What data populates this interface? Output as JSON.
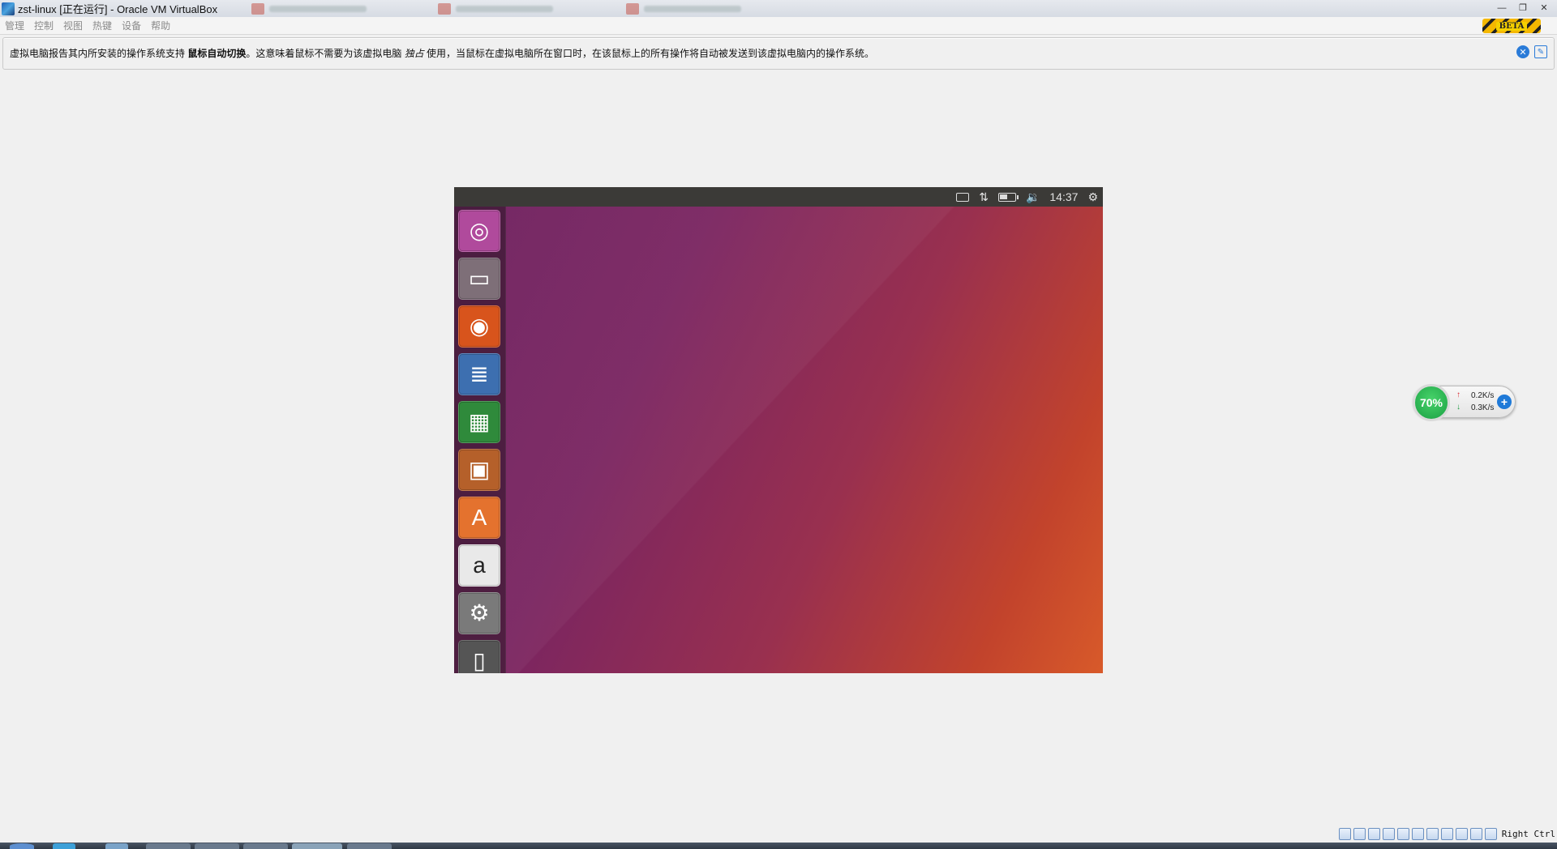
{
  "window": {
    "title": "zst-linux [正在运行] - Oracle VM VirtualBox",
    "controls": [
      "—",
      "❐",
      "✕"
    ]
  },
  "menu": [
    "管理",
    "控制",
    "视图",
    "热键",
    "设备",
    "帮助"
  ],
  "beta_label": "BETA",
  "notification": {
    "part1": "虚拟电脑报告其内所安装的操作系统支持 ",
    "bold": "鼠标自动切换",
    "part2": "。这意味着鼠标不需要为该虚拟电脑 ",
    "italic": "独占",
    "part3": " 使用，当鼠标在虚拟电脑所在窗口时，在该鼠标上的所有操作将自动被发送到该虚拟电脑内的操作系统。"
  },
  "vm": {
    "clock": "14:37",
    "battery_level": 0.5,
    "launcher_apps": [
      {
        "name": "Ubuntu Dash",
        "icon": "dash-icon",
        "color": "#b04a9c"
      },
      {
        "name": "Files",
        "icon": "files-icon",
        "color": "#7e6f78"
      },
      {
        "name": "Firefox",
        "icon": "firefox-icon",
        "color": "#d8541c"
      },
      {
        "name": "LibreOffice Writer",
        "icon": "writer-icon",
        "color": "#3d6fb0"
      },
      {
        "name": "LibreOffice Calc",
        "icon": "calc-icon",
        "color": "#2f8a3b"
      },
      {
        "name": "LibreOffice Impress",
        "icon": "impress-icon",
        "color": "#b5602a"
      },
      {
        "name": "Ubuntu Software",
        "icon": "software-icon",
        "color": "#e4722e"
      },
      {
        "name": "Amazon",
        "icon": "amazon-icon",
        "color": "#e9e9e9"
      },
      {
        "name": "System Settings",
        "icon": "settings-icon",
        "color": "#7a7a7a"
      },
      {
        "name": "Trash",
        "icon": "trash-icon",
        "color": "#555"
      }
    ]
  },
  "net_widget": {
    "percent": "70%",
    "up": "0.2K/s",
    "down": "0.3K/s"
  },
  "statusbar": {
    "host_key": "Right Ctrl"
  }
}
